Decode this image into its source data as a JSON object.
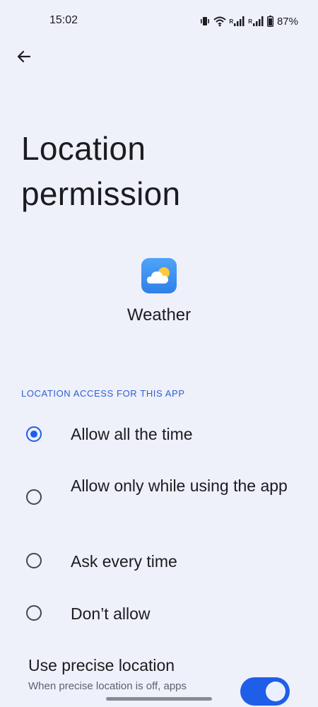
{
  "status_bar": {
    "time": "15:02",
    "battery": "87%",
    "network_label_1": "R",
    "network_label_2": "R",
    "icons": [
      "vibrate-icon",
      "wifi-icon",
      "signal-icon",
      "signal-icon",
      "battery-icon"
    ]
  },
  "header": {
    "back_icon": "arrow-left-icon",
    "title": "Location permission"
  },
  "app": {
    "icon": "weather-app-icon",
    "name": "Weather"
  },
  "section": {
    "header": "LOCATION ACCESS FOR THIS APP"
  },
  "options": [
    {
      "label": "Allow all the time",
      "selected": true
    },
    {
      "label": "Allow only while using the app",
      "selected": false
    },
    {
      "label": "Ask every time",
      "selected": false
    },
    {
      "label": "Don’t allow",
      "selected": false
    }
  ],
  "precise_location": {
    "title": "Use precise location",
    "description": "When precise location is off, apps",
    "enabled": true
  },
  "colors": {
    "background": "#eef0fa",
    "accent": "#1f5ee8",
    "section_header": "#2f5fd0"
  }
}
